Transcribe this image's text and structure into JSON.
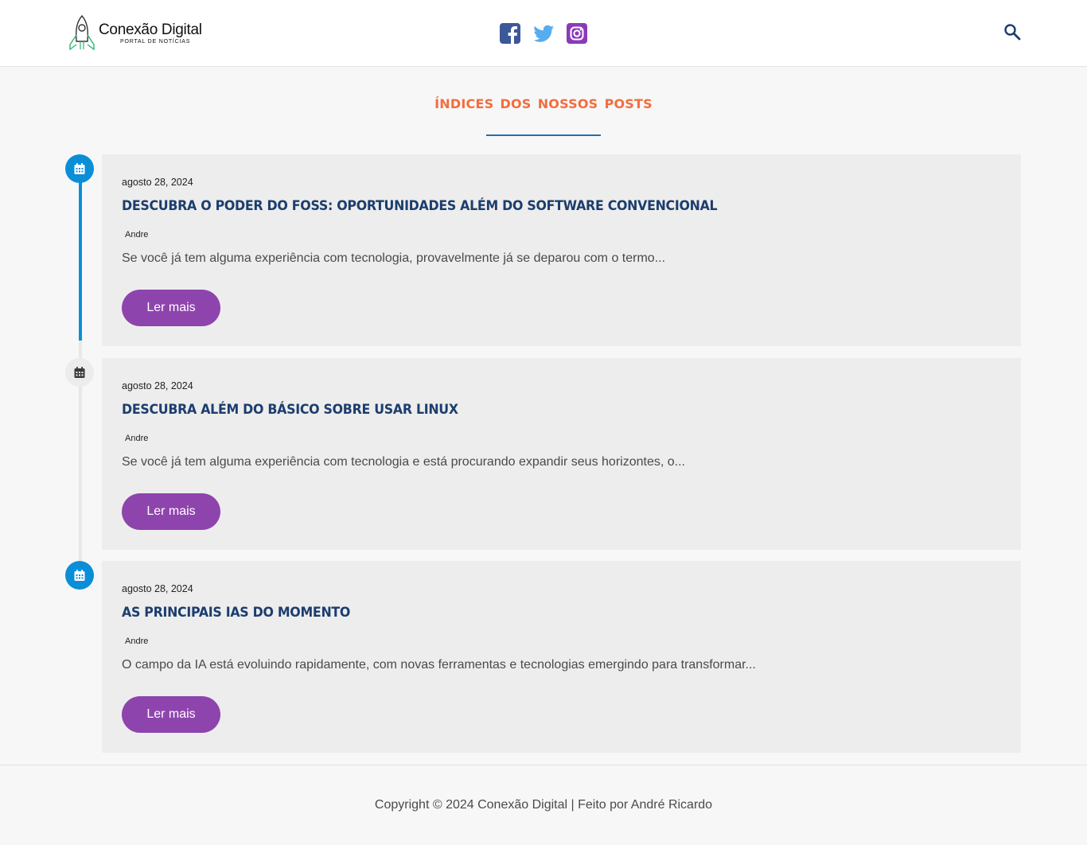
{
  "header": {
    "logo_title": "Conexão Digital",
    "logo_subtitle": "PORTAL DE NOTÍCIAS",
    "social": [
      {
        "icon": "facebook-icon",
        "color": "#3b5998"
      },
      {
        "icon": "twitter-icon",
        "color": "#55acee"
      },
      {
        "icon": "instagram-icon",
        "color": "#8a3ab9"
      }
    ],
    "search_icon": "search-icon"
  },
  "main": {
    "title": "Índices dos Nossos Posts",
    "posts": [
      {
        "date": "agosto 28, 2024",
        "title": "Descubra o Poder do FOSS: Oportunidades Além do Software Convencional",
        "author": "Andre",
        "excerpt": "Se você já tem alguma experiência com tecnologia, provavelmente já se deparou com o termo...",
        "button": "Ler mais",
        "marker_state": "active"
      },
      {
        "date": "agosto 28, 2024",
        "title": "Descubra Além do Básico Sobre Usar Linux",
        "author": "Andre",
        "excerpt": "Se você já tem alguma experiência com tecnologia e está procurando expandir seus horizontes, o...",
        "button": "Ler mais",
        "marker_state": "inactive"
      },
      {
        "date": "agosto 28, 2024",
        "title": "As principais IAs do momento",
        "author": "Andre",
        "excerpt": "O campo da IA está evoluindo rapidamente, com novas ferramentas e tecnologias emergindo para transformar...",
        "button": "Ler mais",
        "marker_state": "active"
      }
    ]
  },
  "footer": {
    "copyright": "Copyright © 2024 Conexão Digital | Feito por André Ricardo"
  },
  "colors": {
    "accent_title": "#f26d3f",
    "heading": "#1c3d6e",
    "button": "#8e44ad",
    "timeline": "#0a8ed8"
  }
}
